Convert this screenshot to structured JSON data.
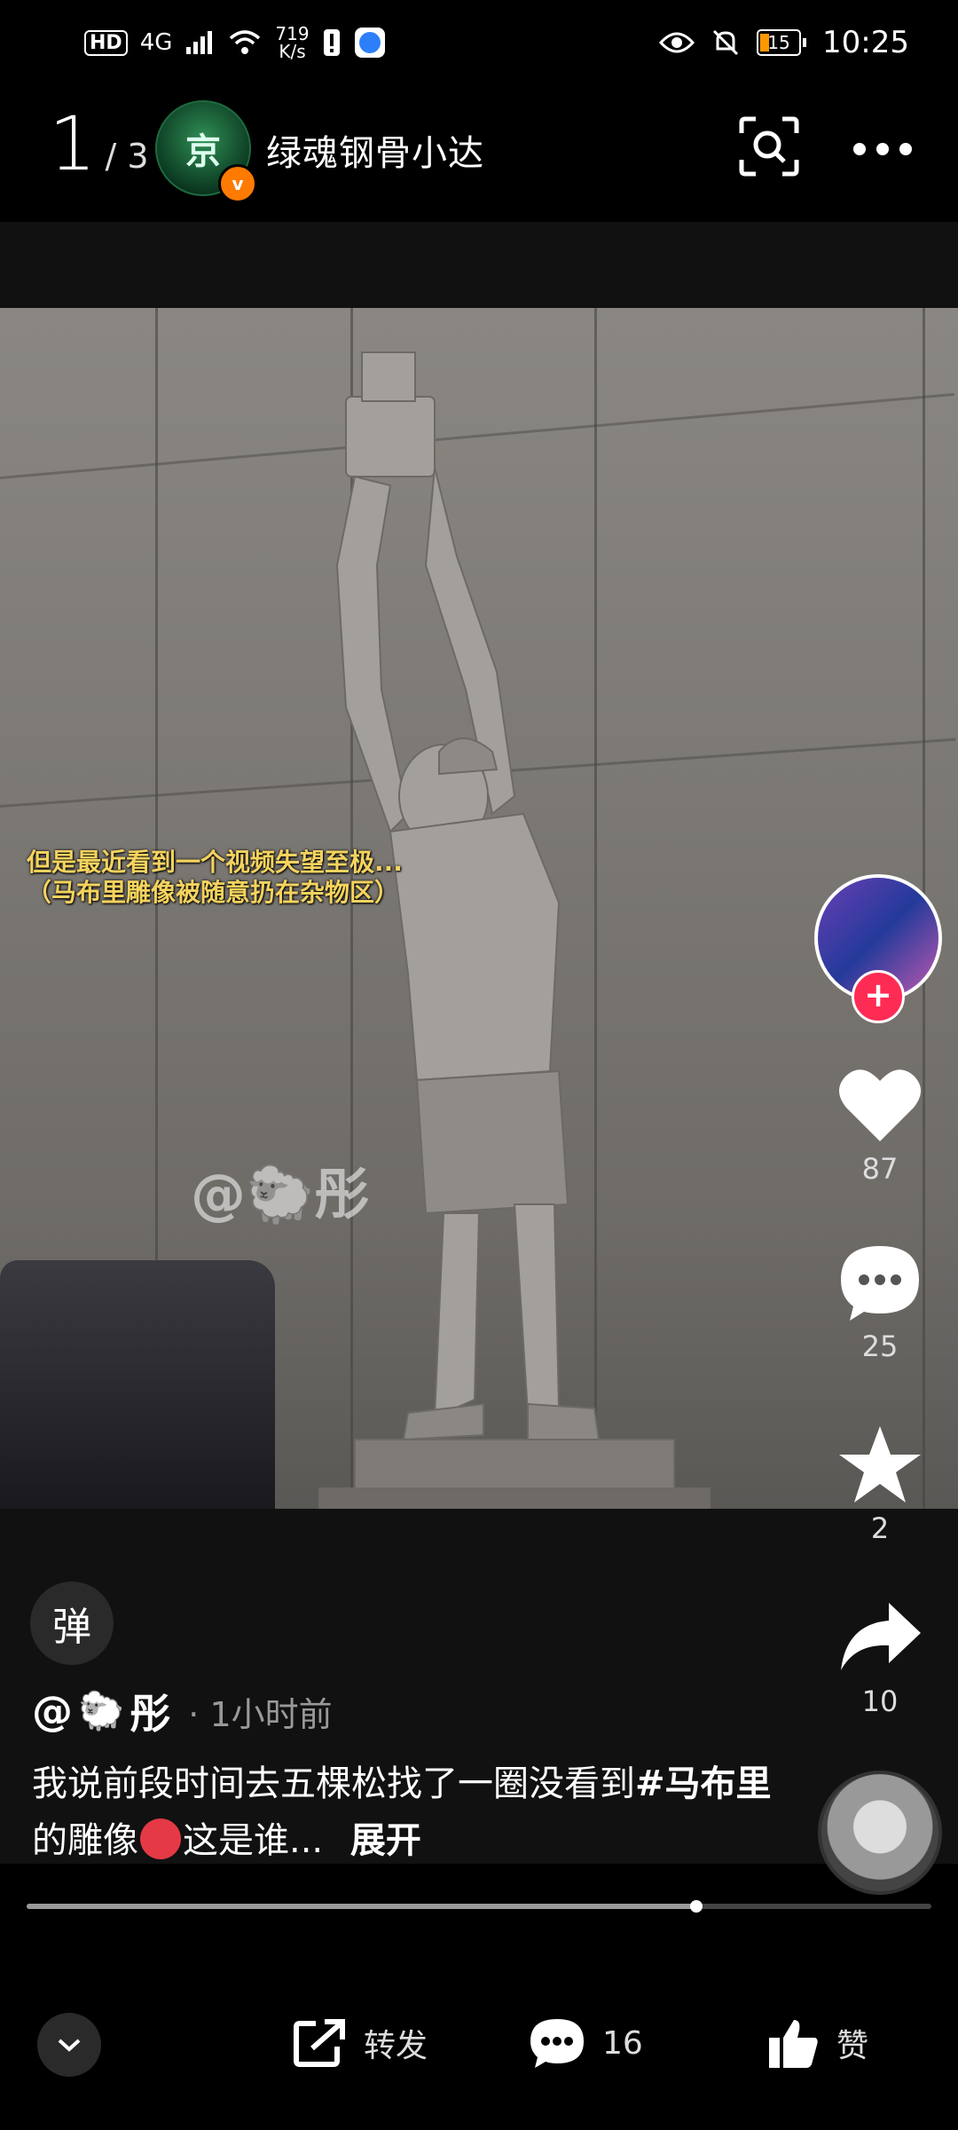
{
  "status_bar": {
    "hd": "HD",
    "network": "4G",
    "speed_value": "719",
    "speed_unit": "K/s",
    "battery": "15",
    "time": "10:25"
  },
  "header": {
    "current_index": "1",
    "total": "/ 3",
    "author_name": "绿魂钢骨小达",
    "avatar_glyph": "京",
    "verified_glyph": "v"
  },
  "video": {
    "overlay_line1": "但是最近看到一个视频失望至极...",
    "overlay_line2": "（马布里雕像被随意扔在杂物区）",
    "watermark": "@🐑彤"
  },
  "actions": {
    "likes": "87",
    "comments": "25",
    "favorites": "2",
    "shares": "10"
  },
  "caption": {
    "danmu_label": "弹",
    "handle_at": "@",
    "handle_emoji": "🐑",
    "handle_name": "彤",
    "time_ago": "· 1小时前",
    "text_part1": "我说前段时间去五棵松找了一圈没看到",
    "hashtag": "#马布里",
    "text_part2": "的雕像",
    "text_part3": "这是谁...",
    "expand": "展开"
  },
  "progress": {
    "fraction": 0.74
  },
  "bottom_bar": {
    "share_label": "转发",
    "comment_count": "16",
    "like_label": "赞"
  },
  "colors": {
    "accent_red": "#fe2c55",
    "verified_orange": "#ff7a00",
    "overlay_yellow": "#f4d35e"
  }
}
